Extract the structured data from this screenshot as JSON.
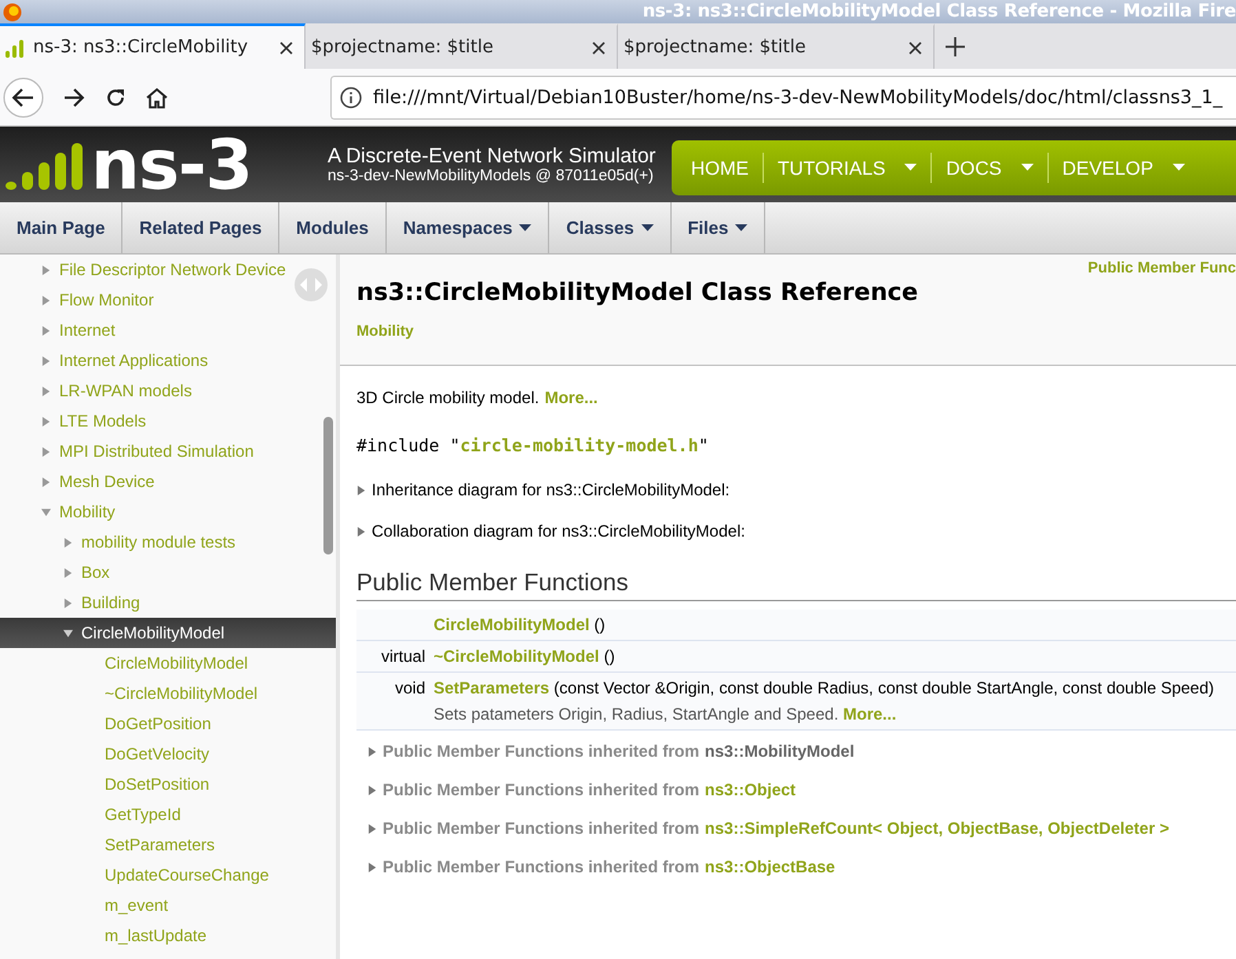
{
  "window": {
    "title": "ns-3: ns3::CircleMobilityModel Class Reference - Mozilla Fire"
  },
  "tabs": [
    {
      "label": "ns-3: ns3::CircleMobility",
      "selected": true
    },
    {
      "label": "$projectname: $title",
      "selected": false
    },
    {
      "label": "$projectname: $title",
      "selected": false
    }
  ],
  "address_bar": {
    "url": "file:///mnt/Virtual/Debian10Buster/home/ns-3-dev-NewMobilityModels/doc/html/classns3_1_"
  },
  "site_header": {
    "logo": "ns-3",
    "tagline": "A Discrete-Event Network Simulator",
    "version": "ns-3-dev-NewMobilityModels @ 87011e05d(+)",
    "menu": [
      {
        "label": "HOME",
        "has_menu": false
      },
      {
        "label": "TUTORIALS",
        "has_menu": true
      },
      {
        "label": "DOCS",
        "has_menu": true
      },
      {
        "label": "DEVELOP",
        "has_menu": true
      }
    ]
  },
  "doc_tabs": [
    {
      "label": "Main Page",
      "has_menu": false
    },
    {
      "label": "Related Pages",
      "has_menu": false
    },
    {
      "label": "Modules",
      "has_menu": false
    },
    {
      "label": "Namespaces",
      "has_menu": true
    },
    {
      "label": "Classes",
      "has_menu": true
    },
    {
      "label": "Files",
      "has_menu": true
    }
  ],
  "sidebar": {
    "items": [
      {
        "label": "File Descriptor Network Device",
        "kind": "group",
        "expanded": false,
        "selected": false
      },
      {
        "label": "Flow Monitor",
        "kind": "group",
        "expanded": false,
        "selected": false
      },
      {
        "label": "Internet",
        "kind": "group",
        "expanded": false,
        "selected": false
      },
      {
        "label": "Internet Applications",
        "kind": "group",
        "expanded": false,
        "selected": false
      },
      {
        "label": "LR-WPAN models",
        "kind": "group",
        "expanded": false,
        "selected": false
      },
      {
        "label": "LTE Models",
        "kind": "group",
        "expanded": false,
        "selected": false
      },
      {
        "label": "MPI Distributed Simulation",
        "kind": "group",
        "expanded": false,
        "selected": false
      },
      {
        "label": "Mesh Device",
        "kind": "group",
        "expanded": false,
        "selected": false
      },
      {
        "label": "Mobility",
        "kind": "group",
        "expanded": true,
        "selected": false,
        "children": [
          {
            "label": "mobility module tests",
            "kind": "group",
            "expanded": false,
            "selected": false
          },
          {
            "label": "Box",
            "kind": "group",
            "expanded": false,
            "selected": false
          },
          {
            "label": "Building",
            "kind": "group",
            "expanded": false,
            "selected": false
          },
          {
            "label": "CircleMobilityModel",
            "kind": "group",
            "expanded": true,
            "selected": true,
            "children": [
              {
                "label": "CircleMobilityModel",
                "kind": "member",
                "selected": false
              },
              {
                "label": "~CircleMobilityModel",
                "kind": "member",
                "selected": false
              },
              {
                "label": "DoGetPosition",
                "kind": "member",
                "selected": false
              },
              {
                "label": "DoGetVelocity",
                "kind": "member",
                "selected": false
              },
              {
                "label": "DoSetPosition",
                "kind": "member",
                "selected": false
              },
              {
                "label": "GetTypeId",
                "kind": "member",
                "selected": false
              },
              {
                "label": "SetParameters",
                "kind": "member",
                "selected": false
              },
              {
                "label": "UpdateCourseChange",
                "kind": "member",
                "selected": false
              },
              {
                "label": "m_event",
                "kind": "member",
                "selected": false
              },
              {
                "label": "m_lastUpdate",
                "kind": "member",
                "selected": false
              }
            ]
          }
        ]
      }
    ]
  },
  "content": {
    "summary_link": "Public Member Func",
    "title": "ns3::CircleMobilityModel Class Reference",
    "group": "Mobility",
    "brief": "3D Circle mobility model.",
    "brief_more": "More...",
    "include_prefix": "#include \"",
    "include_file": "circle-mobility-model.h",
    "include_suffix": "\"",
    "diagrams": [
      {
        "label": "Inheritance diagram for ns3::CircleMobilityModel:",
        "expanded": false
      },
      {
        "label": "Collaboration diagram for ns3::CircleMobilityModel:",
        "expanded": false
      }
    ],
    "section_title": "Public Member Functions",
    "members": [
      {
        "name": "CircleMobilityModel",
        "args": " ()"
      },
      {
        "type": "virtual",
        "name": "~CircleMobilityModel",
        "args": " ()"
      },
      {
        "type": "void",
        "name": "SetParameters",
        "args": " (const Vector &Origin, const double Radius, const double StartAngle, const double Speed)",
        "description": "Sets patameters Origin, Radius, StartAngle and Speed.",
        "more": "More..."
      }
    ],
    "inherited": [
      {
        "label": "Public Member Functions inherited from",
        "base": "ns3::MobilityModel",
        "linked": false,
        "expanded": false
      },
      {
        "label": "Public Member Functions inherited from",
        "base": "ns3::Object",
        "linked": true,
        "expanded": false
      },
      {
        "label": "Public Member Functions inherited from",
        "base": "ns3::SimpleRefCount< Object, ObjectBase, ObjectDeleter >",
        "linked": true,
        "expanded": false
      },
      {
        "label": "Public Member Functions inherited from",
        "base": "ns3::ObjectBase",
        "linked": true,
        "expanded": false
      }
    ]
  }
}
